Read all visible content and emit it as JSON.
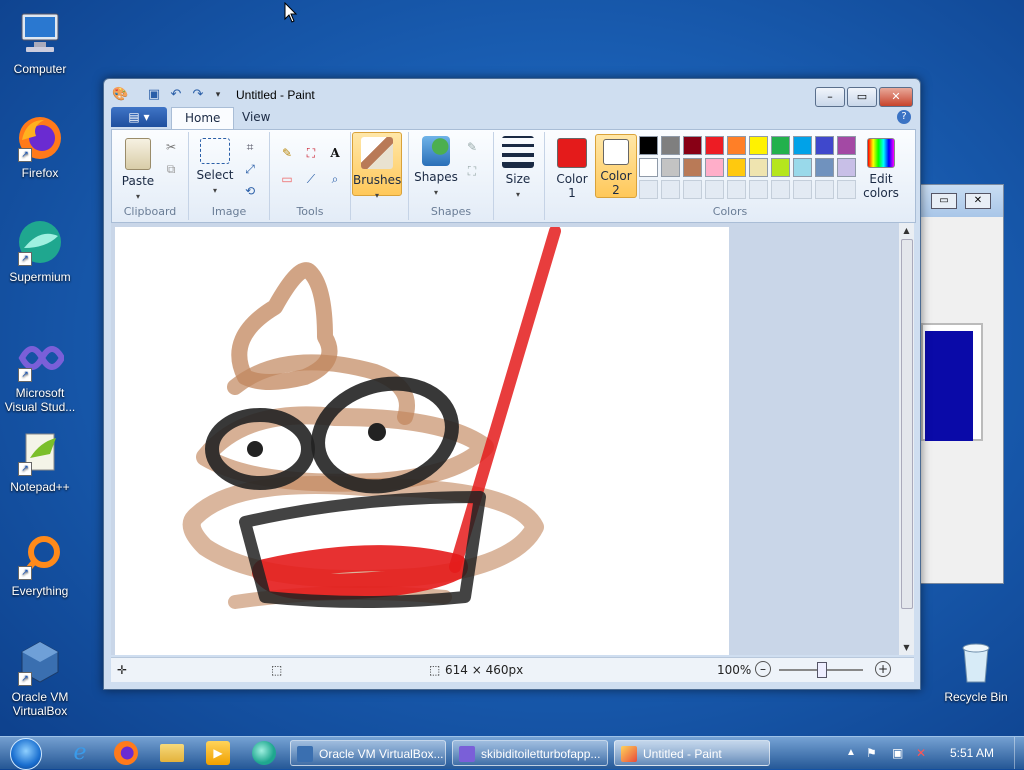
{
  "desktop": {
    "icons": [
      {
        "label": "Computer"
      },
      {
        "label": "Firefox"
      },
      {
        "label": "Supermium"
      },
      {
        "label": "Microsoft Visual Stud..."
      },
      {
        "label": "Notepad++"
      },
      {
        "label": "Everything"
      },
      {
        "label": "Oracle VM VirtualBox"
      },
      {
        "label": "Recycle Bin"
      }
    ]
  },
  "paint": {
    "title": "Untitled - Paint",
    "file_tab": "▤ ▾",
    "tabs": [
      "Home",
      "View"
    ],
    "groups": {
      "clipboard": "Clipboard",
      "image": "Image",
      "tools": "Tools",
      "shapes": "Shapes",
      "colors": "Colors"
    },
    "buttons": {
      "paste": "Paste",
      "select": "Select",
      "brushes": "Brushes",
      "shapes": "Shapes",
      "size": "Size",
      "color1": "Color",
      "color1_num": "1",
      "color2": "Color",
      "color2_num": "2",
      "edit_colors": "Edit",
      "edit_colors2": "colors"
    },
    "color1_value": "#e41b1b",
    "color2_value": "#ffffff",
    "palette_row1": [
      "#000000",
      "#7f7f7f",
      "#880015",
      "#ed1c24",
      "#ff7f27",
      "#fff200",
      "#22b14c",
      "#00a2e8",
      "#3f48cc",
      "#a349a4"
    ],
    "palette_row2": [
      "#ffffff",
      "#c3c3c3",
      "#b97a57",
      "#ffaec9",
      "#ffc90e",
      "#efe4b0",
      "#b5e61d",
      "#99d9ea",
      "#7092be",
      "#c8bfe7"
    ],
    "status": {
      "dimensions": "614 × 460px",
      "zoom": "100%"
    }
  },
  "taskbar": {
    "tasks": [
      "Oracle VM VirtualBox...",
      "skibiditoiletturbofapp...",
      "Untitled - Paint"
    ],
    "time": "5:51 AM"
  }
}
